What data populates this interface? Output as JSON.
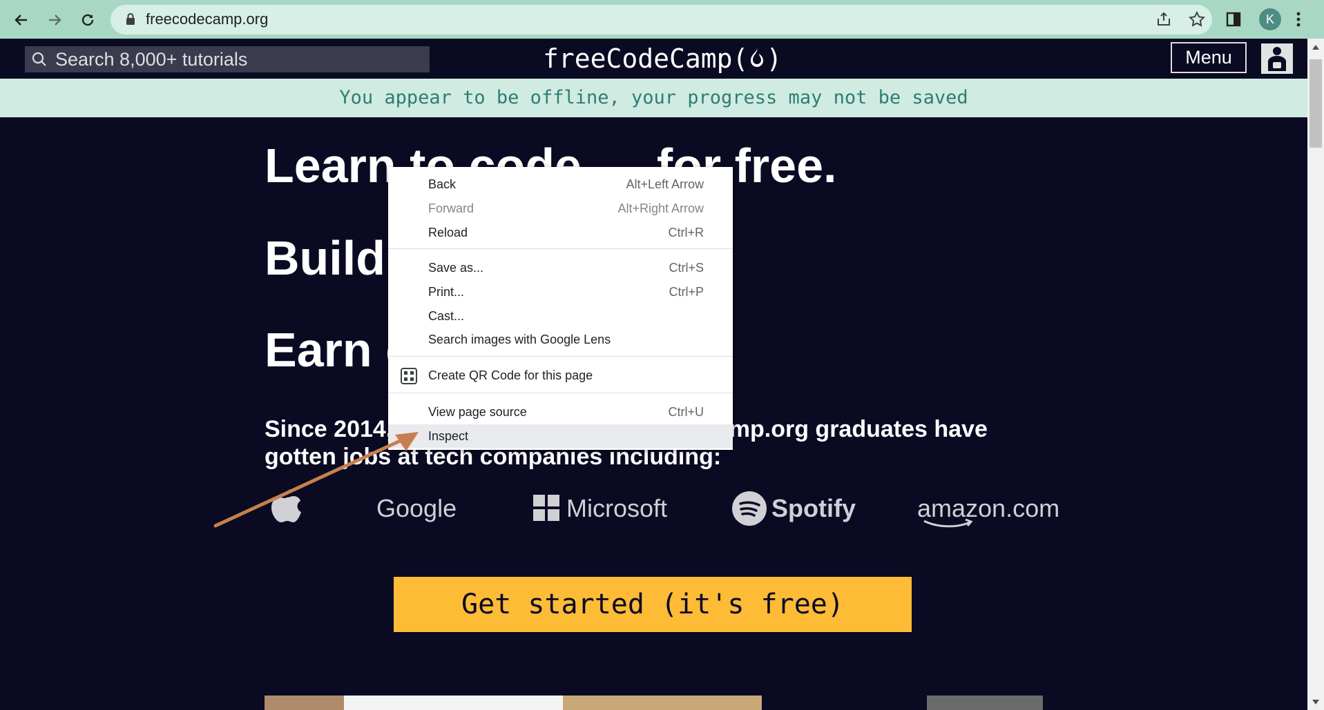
{
  "browser": {
    "url": "freecodecamp.org",
    "profile_initial": "K"
  },
  "nav": {
    "search_placeholder": "Search 8,000+ tutorials",
    "logo_text": "freeCodeCamp(",
    "logo_text_end": ")",
    "menu_label": "Menu"
  },
  "banner": {
    "offline_text": "You appear to be offline, your progress may not be saved"
  },
  "hero": {
    "line1": "Learn to code — for free.",
    "line2": "Build projects.",
    "line3": "Earn certifications.",
    "since_text": "Since 2014, more than 40,000 freeCodeCamp.org graduates have gotten jobs at tech companies including:",
    "companies": [
      "Google",
      "Microsoft",
      "Spotify",
      "amazon.com"
    ],
    "cta_label": "Get started (it's free)"
  },
  "context_menu": {
    "items": [
      {
        "label": "Back",
        "shortcut": "Alt+Left Arrow"
      },
      {
        "label": "Forward",
        "shortcut": "Alt+Right Arrow"
      },
      {
        "label": "Reload",
        "shortcut": "Ctrl+R"
      },
      {
        "label": "Save as...",
        "shortcut": "Ctrl+S"
      },
      {
        "label": "Print...",
        "shortcut": "Ctrl+P"
      },
      {
        "label": "Cast..."
      },
      {
        "label": "Search images with Google Lens"
      },
      {
        "label": "Create QR Code for this page"
      },
      {
        "label": "View page source",
        "shortcut": "Ctrl+U"
      },
      {
        "label": "Inspect"
      }
    ]
  },
  "colors": {
    "chrome_bar": "#a8d8c4",
    "page_bg": "#0a0a23",
    "cta_bg": "#febb36",
    "arrow": "#c87f4f"
  }
}
